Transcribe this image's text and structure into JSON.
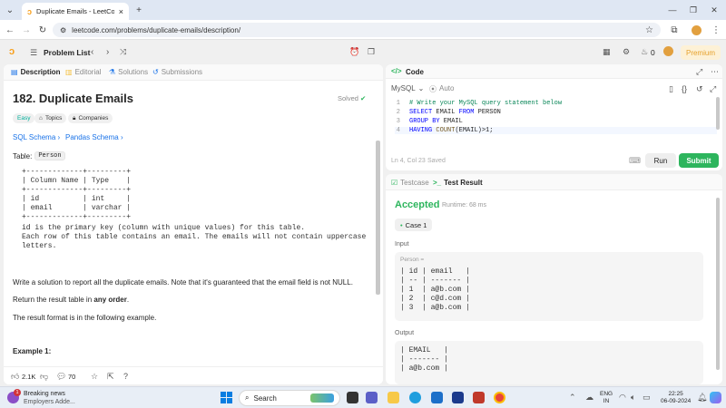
{
  "browser": {
    "tab_title": "Duplicate Emails - LeetCode",
    "tab_close": "×",
    "new_tab": "+",
    "url": "leetcode.com/problems/duplicate-emails/description/",
    "window_controls": {
      "minimize": "—",
      "maximize": "❐",
      "close": "✕"
    }
  },
  "lcnav": {
    "problem_list": "Problem List",
    "streak_count": "0",
    "premium": "Premium"
  },
  "left": {
    "tabs": [
      {
        "label": "Description",
        "icon": "description-icon"
      },
      {
        "label": "Editorial",
        "icon": "editorial-icon"
      },
      {
        "label": "Solutions",
        "icon": "solutions-icon"
      },
      {
        "label": "Submissions",
        "icon": "submissions-icon"
      }
    ],
    "title": "182. Duplicate Emails",
    "solved": "Solved",
    "pills": {
      "easy": "Easy",
      "topics": "Topics",
      "companies": "Companies"
    },
    "links": {
      "sql": "SQL Schema",
      "pandas": "Pandas Schema"
    },
    "table_label": "Table:",
    "table_name": "Person",
    "schema_block": "+-------------+---------+\n| Column Name | Type    |\n+-------------+---------+\n| id          | int     |\n| email       | varchar |\n+-------------+---------+",
    "schema_notes": "id is the primary key (column with unique values) for this table.\nEach row of this table contains an email. The emails will not contain uppercase\nletters.",
    "para1": "Write a solution to report all the duplicate emails. Note that it's guaranteed that the email field is not NULL.",
    "para2_prefix": "Return the result table in ",
    "para2_bold": "any order",
    "para2_suffix": ".",
    "para3": "The result format is in the following example.",
    "example_heading": "Example 1:",
    "likes": "2.1K",
    "comments": "70"
  },
  "code": {
    "header": "Code",
    "language": "MySQL",
    "autocomplete": "Auto",
    "lines": [
      {
        "n": "1",
        "text": "# Write your MySQL query statement below"
      },
      {
        "n": "2",
        "kw1": "SELECT",
        "mid": " EMAIL ",
        "kw2": "FROM",
        "rest": " PERSON"
      },
      {
        "n": "3",
        "kw1": "GROUP BY",
        "rest": " EMAIL"
      },
      {
        "n": "4",
        "kw1": "HAVING",
        "fn": " COUNT",
        "rest": "(EMAIL)>1;"
      }
    ],
    "status_pos": "Ln 4, Col 23",
    "status_saved": "Saved",
    "run": "Run",
    "submit": "Submit"
  },
  "test": {
    "tab_testcase": "Testcase",
    "tab_result": "Test Result",
    "accepted": "Accepted",
    "runtime": "Runtime: 68 ms",
    "case": "Case 1",
    "input_label": "Input",
    "person_label": "Person =",
    "input_table": "| id | email   |\n| -- | ------- |\n| 1  | a@b.com |\n| 2  | c@d.com |\n| 3  | a@b.com |",
    "output_label": "Output",
    "output_table": "| EMAIL   |\n| ------- |\n| a@b.com |"
  },
  "taskbar": {
    "news_title": "Breaking news",
    "news_sub": "Employers Adde...",
    "news_badge": "1",
    "search": "Search",
    "lang": "ENG",
    "region": "IN",
    "time": "22:25",
    "date": "06-09-2024"
  },
  "colors": {
    "accent_green": "#2db55d",
    "easy_teal": "#00af9b",
    "premium_orange": "#e6a12c",
    "link_blue": "#1a73e8"
  }
}
